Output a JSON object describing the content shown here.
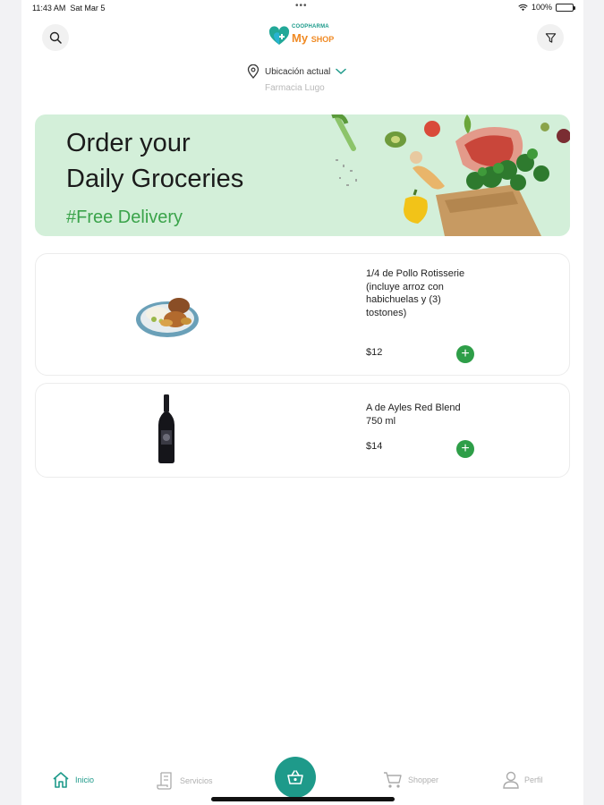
{
  "status_bar": {
    "time": "11:43 AM",
    "date": "Sat Mar 5",
    "dots": "•••",
    "battery": "100%"
  },
  "header": {
    "logo_top": "COOPHARMA",
    "logo_my": "My",
    "logo_shop": "SHOP",
    "location_label": "Ubicación actual",
    "pharmacy_name": "Farmacia Lugo"
  },
  "banner": {
    "title_line1": "Order your",
    "title_line2": "Daily Groceries",
    "subtitle": "#Free Delivery"
  },
  "products": [
    {
      "name": "1/4 de Pollo Rotisserie (incluye arroz con habichuelas y (3) tostones)",
      "price": "$12",
      "add": "+"
    },
    {
      "name": "A de Ayles Red Blend 750 ml",
      "price": "$14",
      "add": "+"
    }
  ],
  "tabs": {
    "home": "Inicio",
    "services": "Servicios",
    "shopper": "Shopper",
    "profile": "Perfil"
  },
  "colors": {
    "brand_teal": "#1e9a8a",
    "add_green": "#2e9e48",
    "banner_bg": "#d3efd9",
    "banner_accent": "#3aa34a"
  },
  "icons": [
    "search-icon",
    "filter-icon",
    "location-pin-icon",
    "chevron-down-icon",
    "plus-icon",
    "home-icon",
    "services-icon",
    "cart-icon",
    "basket-icon",
    "user-icon"
  ]
}
